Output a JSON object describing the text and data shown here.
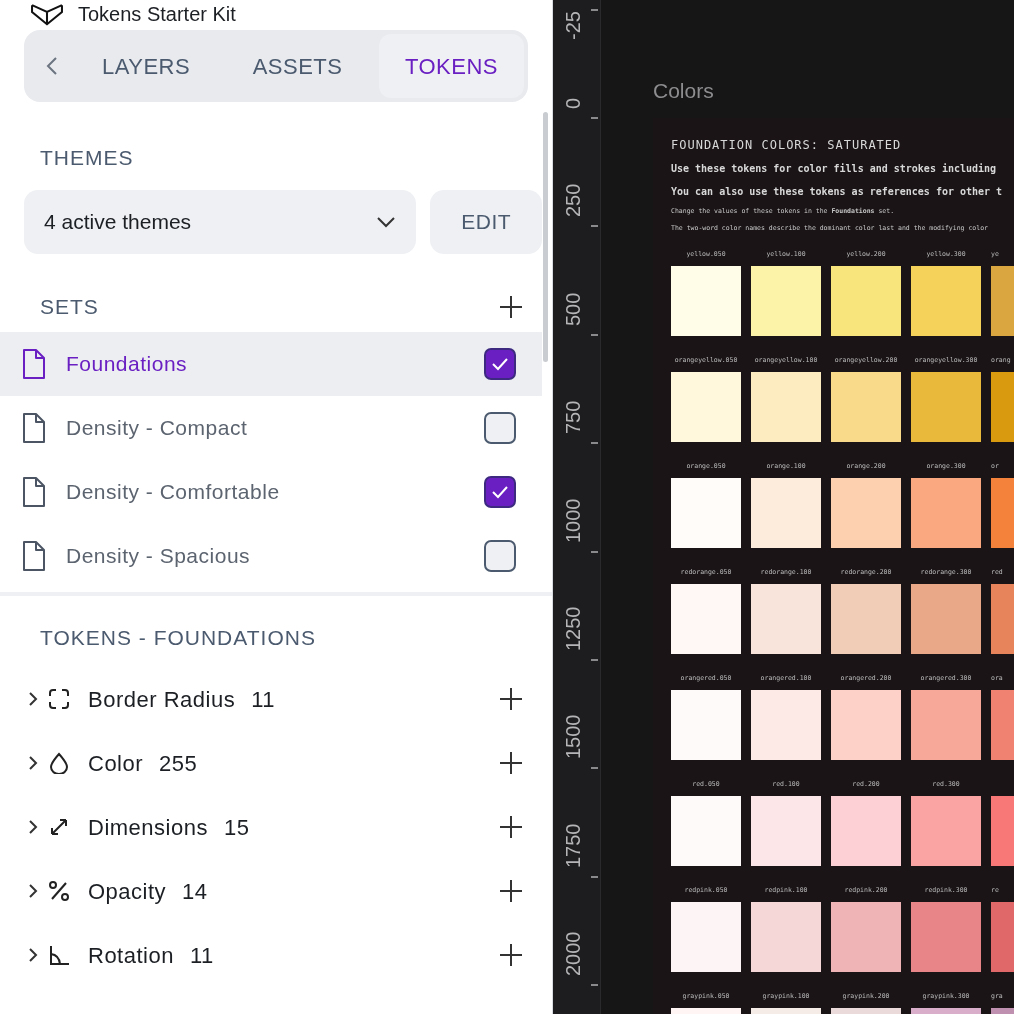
{
  "file": {
    "title": "Tokens Starter Kit"
  },
  "tabs": [
    {
      "label": "LAYERS",
      "selected": false
    },
    {
      "label": "ASSETS",
      "selected": false
    },
    {
      "label": "TOKENS",
      "selected": true
    }
  ],
  "themes": {
    "heading": "THEMES",
    "value": "4 active themes",
    "edit_button": "EDIT"
  },
  "sets": {
    "heading": "SETS",
    "items": [
      {
        "label": "Foundations",
        "selected": true,
        "checked": true
      },
      {
        "label": "Density - Compact",
        "selected": false,
        "checked": false
      },
      {
        "label": "Density - Comfortable",
        "selected": false,
        "checked": true
      },
      {
        "label": "Density - Spacious",
        "selected": false,
        "checked": false
      }
    ]
  },
  "tokens": {
    "heading": "TOKENS - FOUNDATIONS",
    "groups": [
      {
        "kind": "radius",
        "label": "Border Radius",
        "count": "11"
      },
      {
        "kind": "color",
        "label": "Color",
        "count": "255"
      },
      {
        "kind": "dimension",
        "label": "Dimensions",
        "count": "15"
      },
      {
        "kind": "opacity",
        "label": "Opacity",
        "count": "14"
      },
      {
        "kind": "rotation",
        "label": "Rotation",
        "count": "11"
      }
    ]
  },
  "ruler": [
    "-25",
    "0",
    "250",
    "500",
    "750",
    "1000",
    "1250",
    "1500",
    "1750",
    "2000"
  ],
  "canvas": {
    "frame_label": "Colors",
    "title": "FOUNDATION COLORS: SATURATED",
    "lines": [
      "Use these tokens for color fills and strokes including",
      "You can also use these tokens as references for other t"
    ],
    "notes": [
      "Change the values of these tokens in the **Foundations** set.",
      "The two-word color names describe the dominant color last and the modifying color"
    ],
    "swatch_rows": [
      [
        {
          "label": "yellow.050",
          "color": "#fffce8"
        },
        {
          "label": "yellow.100",
          "color": "#fdf3a8"
        },
        {
          "label": "yellow.200",
          "color": "#f8e57c"
        },
        {
          "label": "yellow.300",
          "color": "#f5d35a"
        },
        {
          "label": "ye",
          "color": "#d9a640"
        }
      ],
      [
        {
          "label": "orangeyellow.050",
          "color": "#fff8dc"
        },
        {
          "label": "orangeyellow.100",
          "color": "#fcecc0"
        },
        {
          "label": "orangeyellow.200",
          "color": "#f9d98a"
        },
        {
          "label": "orangeyellow.300",
          "color": "#e8b93a"
        },
        {
          "label": "orang",
          "color": "#d99a10"
        }
      ],
      [
        {
          "label": "orange.050",
          "color": "#fffcfa"
        },
        {
          "label": "orange.100",
          "color": "#fdebdc"
        },
        {
          "label": "orange.200",
          "color": "#fdd0b0"
        },
        {
          "label": "orange.300",
          "color": "#f9a880"
        },
        {
          "label": "or",
          "color": "#f5823a"
        }
      ],
      [
        {
          "label": "redorange.050",
          "color": "#fff8f5"
        },
        {
          "label": "redorange.100",
          "color": "#f9e4dc"
        },
        {
          "label": "redorange.200",
          "color": "#f1cdb8"
        },
        {
          "label": "redorange.300",
          "color": "#e9a888"
        },
        {
          "label": "red",
          "color": "#e8845c"
        }
      ],
      [
        {
          "label": "orangered.050",
          "color": "#fffafa"
        },
        {
          "label": "orangered.100",
          "color": "#fde9e6"
        },
        {
          "label": "orangered.200",
          "color": "#fdd0c8"
        },
        {
          "label": "orangered.300",
          "color": "#f8a898"
        },
        {
          "label": "ora",
          "color": "#ef8270"
        }
      ],
      [
        {
          "label": "red.050",
          "color": "#fffafa"
        },
        {
          "label": "red.100",
          "color": "#fde6e8"
        },
        {
          "label": "red.200",
          "color": "#fcd0d4"
        },
        {
          "label": "red.300",
          "color": "#faa4a4"
        },
        {
          "color": "#f87878"
        }
      ],
      [
        {
          "label": "redpink.050",
          "color": "#fdf5f5"
        },
        {
          "label": "redpink.100",
          "color": "#f5d7d8"
        },
        {
          "label": "redpink.200",
          "color": "#efb4b6"
        },
        {
          "label": "redpink.300",
          "color": "#e88588"
        },
        {
          "label": "re",
          "color": "#e06868"
        }
      ],
      [
        {
          "label": "graypink.050",
          "color": "#fff5f5"
        },
        {
          "label": "graypink.100",
          "color": "#f5ece8"
        },
        {
          "label": "graypink.200",
          "color": "#ebdada"
        },
        {
          "label": "graypink.300",
          "color": "#d8aeca"
        },
        {
          "label": "gra",
          "color": "#c090b0"
        }
      ]
    ]
  }
}
